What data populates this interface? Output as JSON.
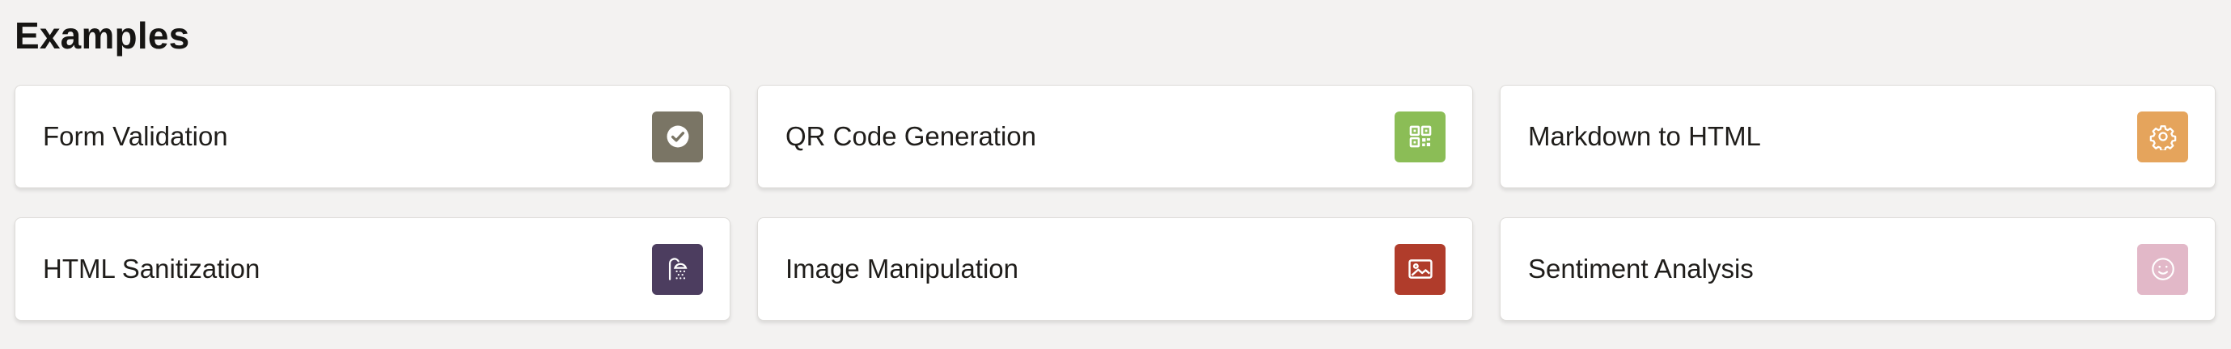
{
  "page": {
    "title": "Examples"
  },
  "cards": [
    {
      "label": "Form Validation",
      "icon": "check-circle-icon",
      "color": "#7a7565"
    },
    {
      "label": "QR Code Generation",
      "icon": "qr-code-icon",
      "color": "#8bbd56"
    },
    {
      "label": "Markdown to HTML",
      "icon": "gear-icon",
      "color": "#e5a45c"
    },
    {
      "label": "HTML Sanitization",
      "icon": "shower-icon",
      "color": "#4c3d5f"
    },
    {
      "label": "Image Manipulation",
      "icon": "image-icon",
      "color": "#b03c2b"
    },
    {
      "label": "Sentiment Analysis",
      "icon": "smiley-icon",
      "color": "#e2b8c8"
    }
  ]
}
